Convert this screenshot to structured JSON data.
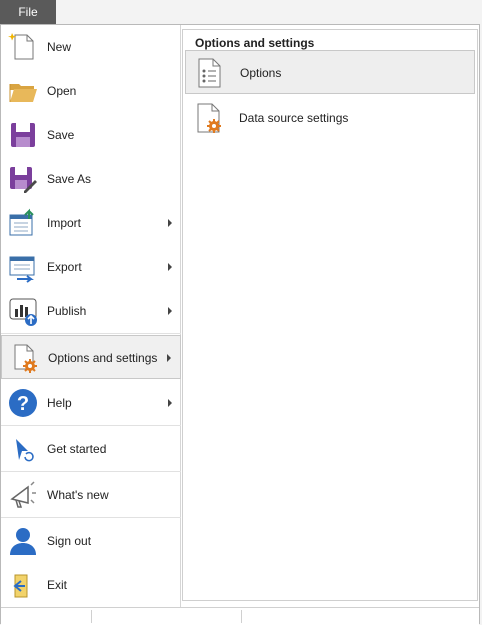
{
  "topbar": {
    "file_label": "File"
  },
  "menu": {
    "items": [
      {
        "label": "New",
        "icon": "new-icon",
        "has_submenu": false
      },
      {
        "label": "Open",
        "icon": "folder-icon",
        "has_submenu": false
      },
      {
        "label": "Save",
        "icon": "save-icon",
        "has_submenu": false
      },
      {
        "label": "Save As",
        "icon": "save-as-icon",
        "has_submenu": false
      },
      {
        "label": "Import",
        "icon": "import-icon",
        "has_submenu": true
      },
      {
        "label": "Export",
        "icon": "export-icon",
        "has_submenu": true
      },
      {
        "label": "Publish",
        "icon": "publish-icon",
        "has_submenu": true
      },
      {
        "label": "Options and settings",
        "icon": "options-gear-icon",
        "has_submenu": true,
        "selected": true
      },
      {
        "label": "Help",
        "icon": "help-icon",
        "has_submenu": true
      },
      {
        "label": "Get started",
        "icon": "get-started-icon",
        "has_submenu": false
      },
      {
        "label": "What's new",
        "icon": "megaphone-icon",
        "has_submenu": false
      },
      {
        "label": "Sign out",
        "icon": "user-icon",
        "has_submenu": false
      },
      {
        "label": "Exit",
        "icon": "exit-icon",
        "has_submenu": false
      }
    ]
  },
  "submenu": {
    "title": "Options and settings",
    "items": [
      {
        "label": "Options",
        "icon": "options-list-icon",
        "selected": true
      },
      {
        "label": "Data source settings",
        "icon": "data-source-gear-icon",
        "selected": false
      }
    ]
  },
  "colors": {
    "file_tab": "#5a5a5a",
    "save_purple": "#7b3f9c",
    "gear_orange": "#e07a1f",
    "help_blue": "#2b6cc4"
  }
}
